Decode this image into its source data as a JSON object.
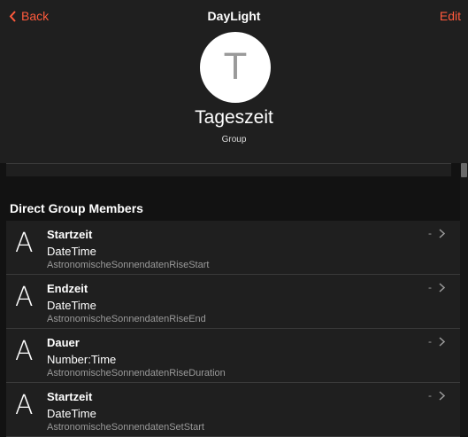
{
  "nav": {
    "back_label": "Back",
    "title": "DayLight",
    "edit_label": "Edit"
  },
  "item": {
    "avatar_letter": "T",
    "name": "Tageszeit",
    "type": "Group"
  },
  "section": {
    "title": "Direct Group Members"
  },
  "members": [
    {
      "icon": "A",
      "label": "Startzeit",
      "type": "DateTime",
      "name": "AstronomischeSonnendatenRiseStart",
      "state": "-"
    },
    {
      "icon": "A",
      "label": "Endzeit",
      "type": "DateTime",
      "name": "AstronomischeSonnendatenRiseEnd",
      "state": "-"
    },
    {
      "icon": "A",
      "label": "Dauer",
      "type": "Number:Time",
      "name": "AstronomischeSonnendatenRiseDuration",
      "state": "-"
    },
    {
      "icon": "A",
      "label": "Startzeit",
      "type": "DateTime",
      "name": "AstronomischeSonnendatenSetStart",
      "state": "-"
    }
  ],
  "colors": {
    "accent": "#ff5a3c",
    "background": "#121212",
    "card": "#1f1f1f",
    "secondary_text": "#9a9a9a"
  },
  "icons": {
    "back": "chevron-left-icon",
    "row": "chevron-right-icon",
    "member_type": "letter-a-icon"
  }
}
